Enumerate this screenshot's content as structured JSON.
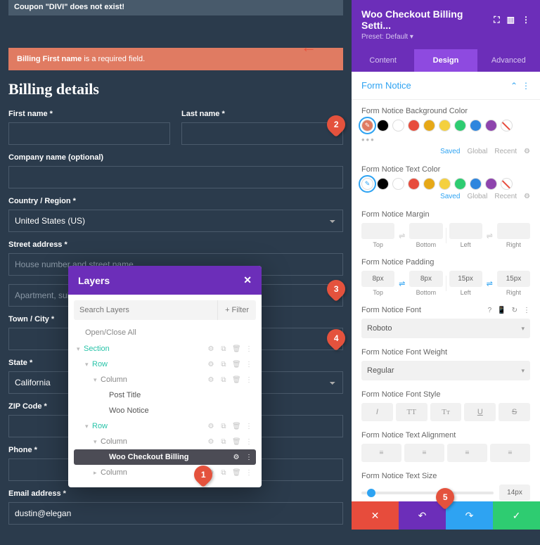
{
  "form": {
    "coupon_error": "Coupon \"DIVI\" does not exist!",
    "notice_bold": "Billing First name",
    "notice_rest": " is a required field.",
    "heading": "Billing details",
    "first_name": "First name *",
    "last_name": "Last name *",
    "company": "Company name (optional)",
    "country": "Country / Region *",
    "country_val": "United States (US)",
    "street": "Street address *",
    "street_ph1": "House number and street name",
    "street_ph2": "Apartment, suite, unit, etc. (optional)",
    "town": "Town / City *",
    "state": "State *",
    "state_val": "California",
    "zip": "ZIP Code *",
    "phone": "Phone *",
    "email": "Email address *",
    "email_val": "dustin@elegan"
  },
  "layers": {
    "title": "Layers",
    "search_ph": "Search Layers",
    "filter": "+ Filter",
    "open_all": "Open/Close All",
    "section": "Section",
    "row": "Row",
    "column": "Column",
    "post_title": "Post Title",
    "woo_notice": "Woo Notice",
    "woo_billing": "Woo Checkout Billing"
  },
  "panel": {
    "title": "Woo Checkout Billing Setti...",
    "preset": "Preset: Default",
    "tab_content": "Content",
    "tab_design": "Design",
    "tab_advanced": "Advanced",
    "section": "Form Notice",
    "bg_label": "Form Notice Background Color",
    "txt_label": "Form Notice Text Color",
    "saved": "Saved",
    "global": "Global",
    "recent": "Recent",
    "margin": "Form Notice Margin",
    "padding": "Form Notice Padding",
    "pad_t": "8px",
    "pad_b": "8px",
    "pad_l": "15px",
    "pad_r": "15px",
    "top": "Top",
    "bottom": "Bottom",
    "left": "Left",
    "right": "Right",
    "font": "Form Notice Font",
    "font_val": "Roboto",
    "weight": "Form Notice Font Weight",
    "weight_val": "Regular",
    "style": "Form Notice Font Style",
    "align": "Form Notice Text Alignment",
    "size": "Form Notice Text Size",
    "size_val": "14px",
    "colors": [
      "#000000",
      "#ffffff",
      "#e74c3c",
      "#e6a817",
      "#f4d03f",
      "#2ecc71",
      "#2e86de",
      "#8e44ad"
    ]
  },
  "badges": {
    "b1": "1",
    "b2": "2",
    "b3": "3",
    "b4": "4",
    "b5": "5"
  }
}
